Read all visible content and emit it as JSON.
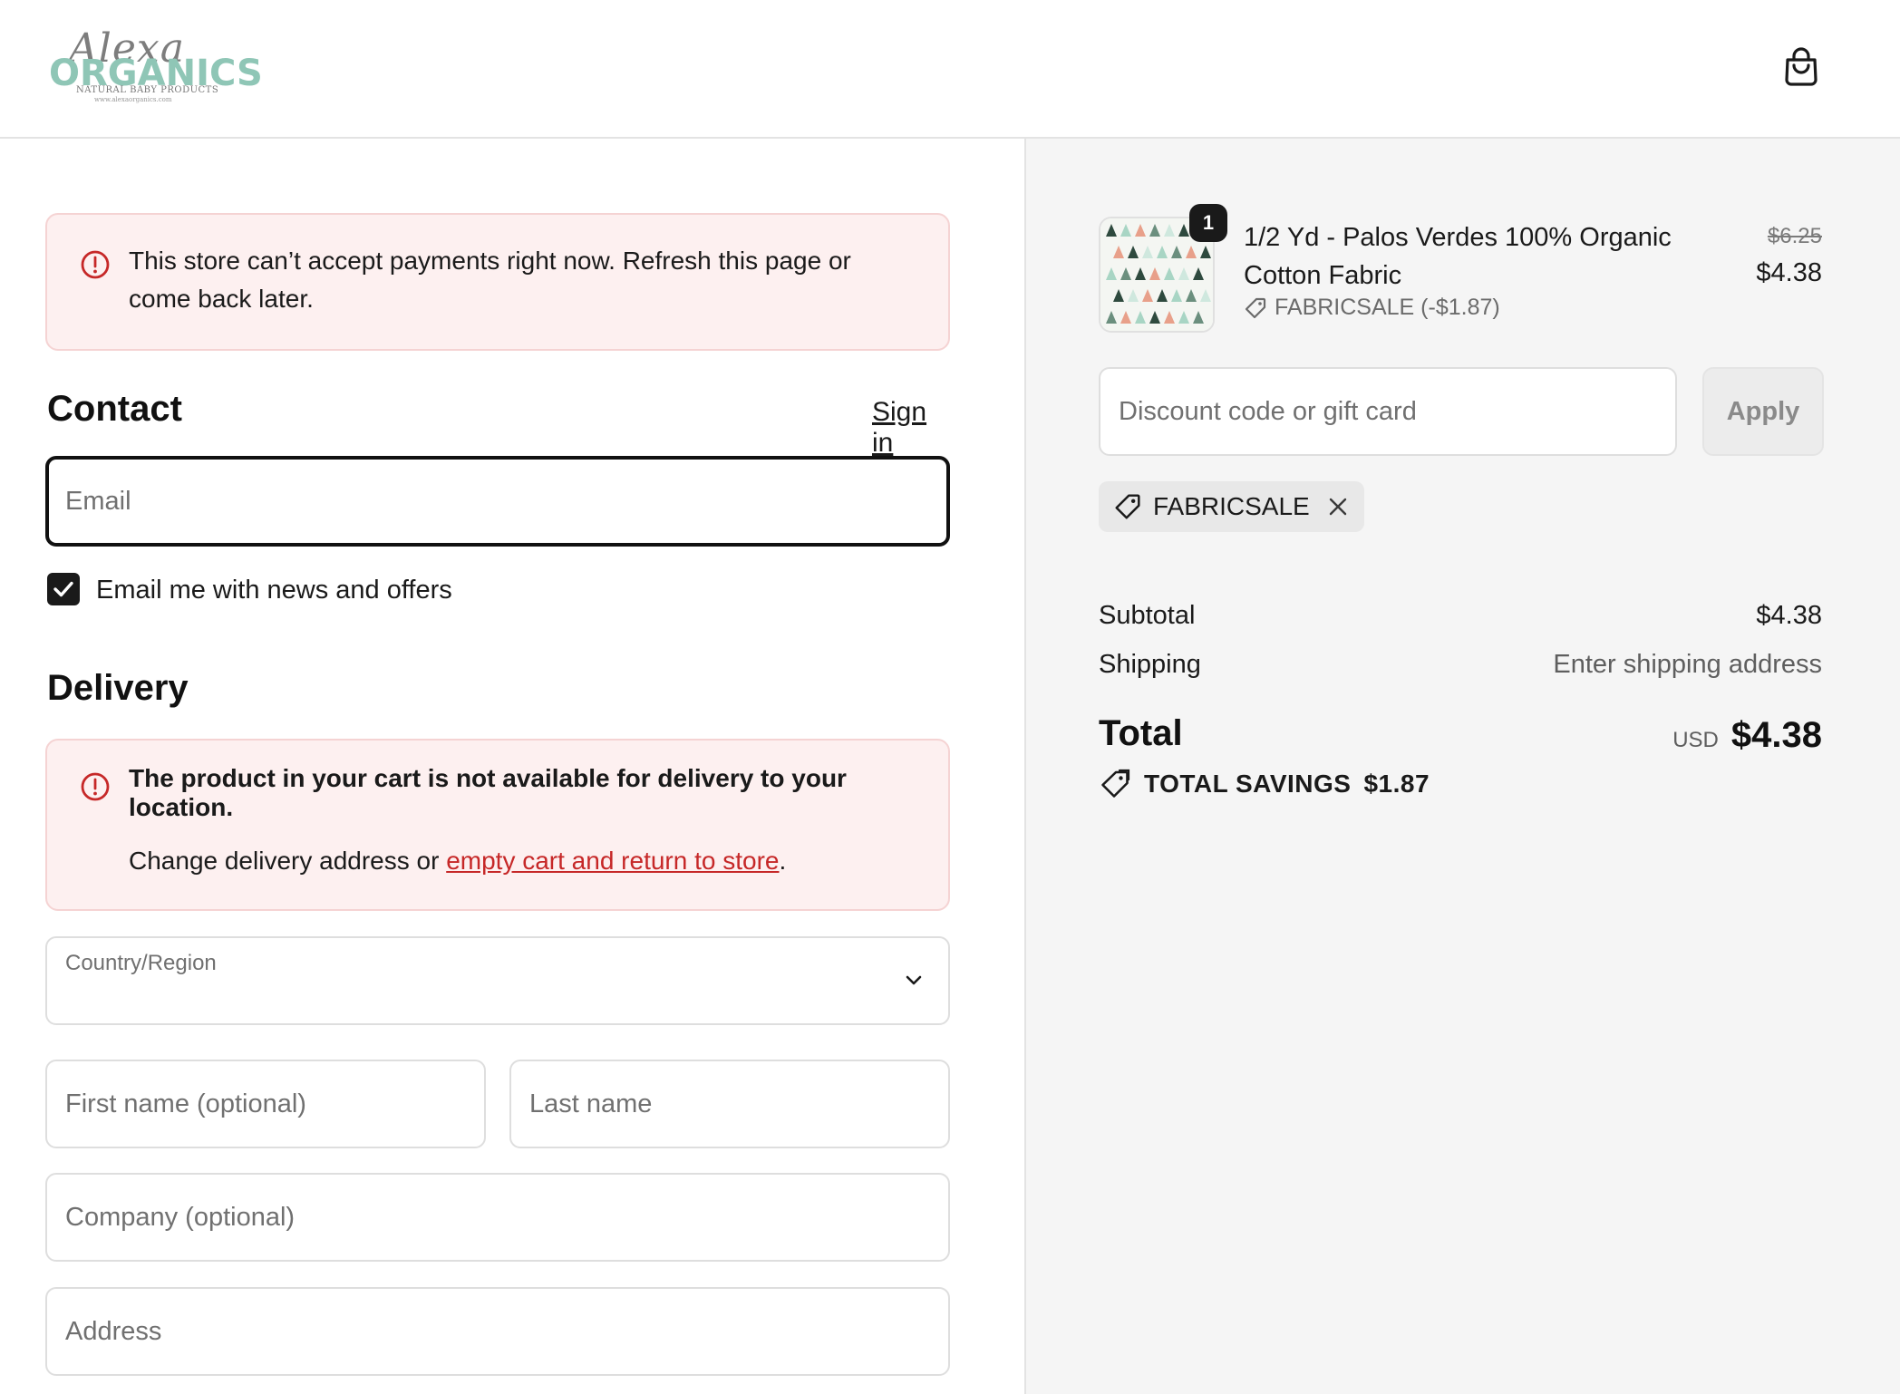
{
  "header": {
    "logo_script": "Alexa",
    "logo_brand": "ORGANICS",
    "logo_tagline": "NATURAL BABY PRODUCTS",
    "logo_url": "www.alexaorganics.com"
  },
  "alerts": {
    "payments": "This store can’t accept payments right now. Refresh this page or come back later.",
    "delivery_title": "The product in your cart is not available for delivery to your location.",
    "delivery_body_prefix": "Change delivery address or ",
    "delivery_link": "empty cart and return to store",
    "delivery_body_suffix": "."
  },
  "contact": {
    "title": "Contact",
    "sign_in": "Sign in",
    "email_placeholder": "Email",
    "newsletter_label": "Email me with news and offers",
    "newsletter_checked": true
  },
  "delivery": {
    "title": "Delivery",
    "country_label": "Country/Region",
    "first_name_placeholder": "First name (optional)",
    "last_name_placeholder": "Last name",
    "company_placeholder": "Company (optional)",
    "address_placeholder": "Address"
  },
  "summary": {
    "item": {
      "quantity": "1",
      "name": "1/2 Yd - Palos Verdes 100% Organic Cotton Fabric",
      "discount": "FABRICSALE (-$1.87)",
      "original_price": "$6.25",
      "price": "$4.38"
    },
    "discount_placeholder": "Discount code or gift card",
    "apply_label": "Apply",
    "applied_code": "FABRICSALE",
    "subtotal_label": "Subtotal",
    "subtotal_value": "$4.38",
    "shipping_label": "Shipping",
    "shipping_value": "Enter shipping address",
    "total_label": "Total",
    "currency": "USD",
    "total_value": "$4.38",
    "savings_label": "TOTAL SAVINGS",
    "savings_value": "$1.87"
  },
  "colors": {
    "error_bg": "#fdf0f0",
    "error_border": "#f5d3d3",
    "error_icon": "#c62828",
    "link_red": "#c62828",
    "brand_teal": "#8fc6b6",
    "summary_bg": "#f5f5f5"
  }
}
